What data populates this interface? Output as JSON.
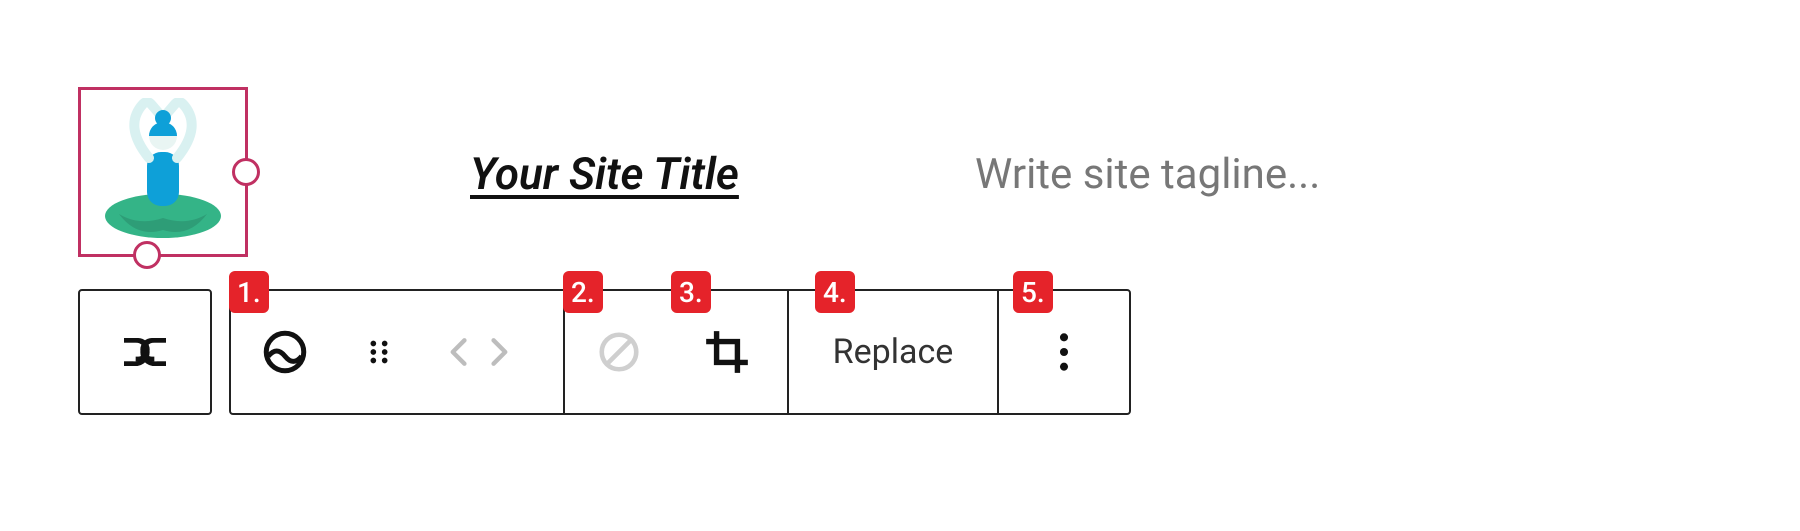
{
  "colors": {
    "select_border": "#c03062",
    "annot": "#e5232a"
  },
  "logo": {
    "alt": "site-logo-image"
  },
  "site_title": "Your Site Title",
  "site_tagline_placeholder": "Write site tagline...",
  "toolbar": {
    "replace_label": "Replace"
  },
  "annotations": {
    "a1": "1.",
    "a2": "2.",
    "a3": "3.",
    "a4": "4.",
    "a5": "5."
  }
}
